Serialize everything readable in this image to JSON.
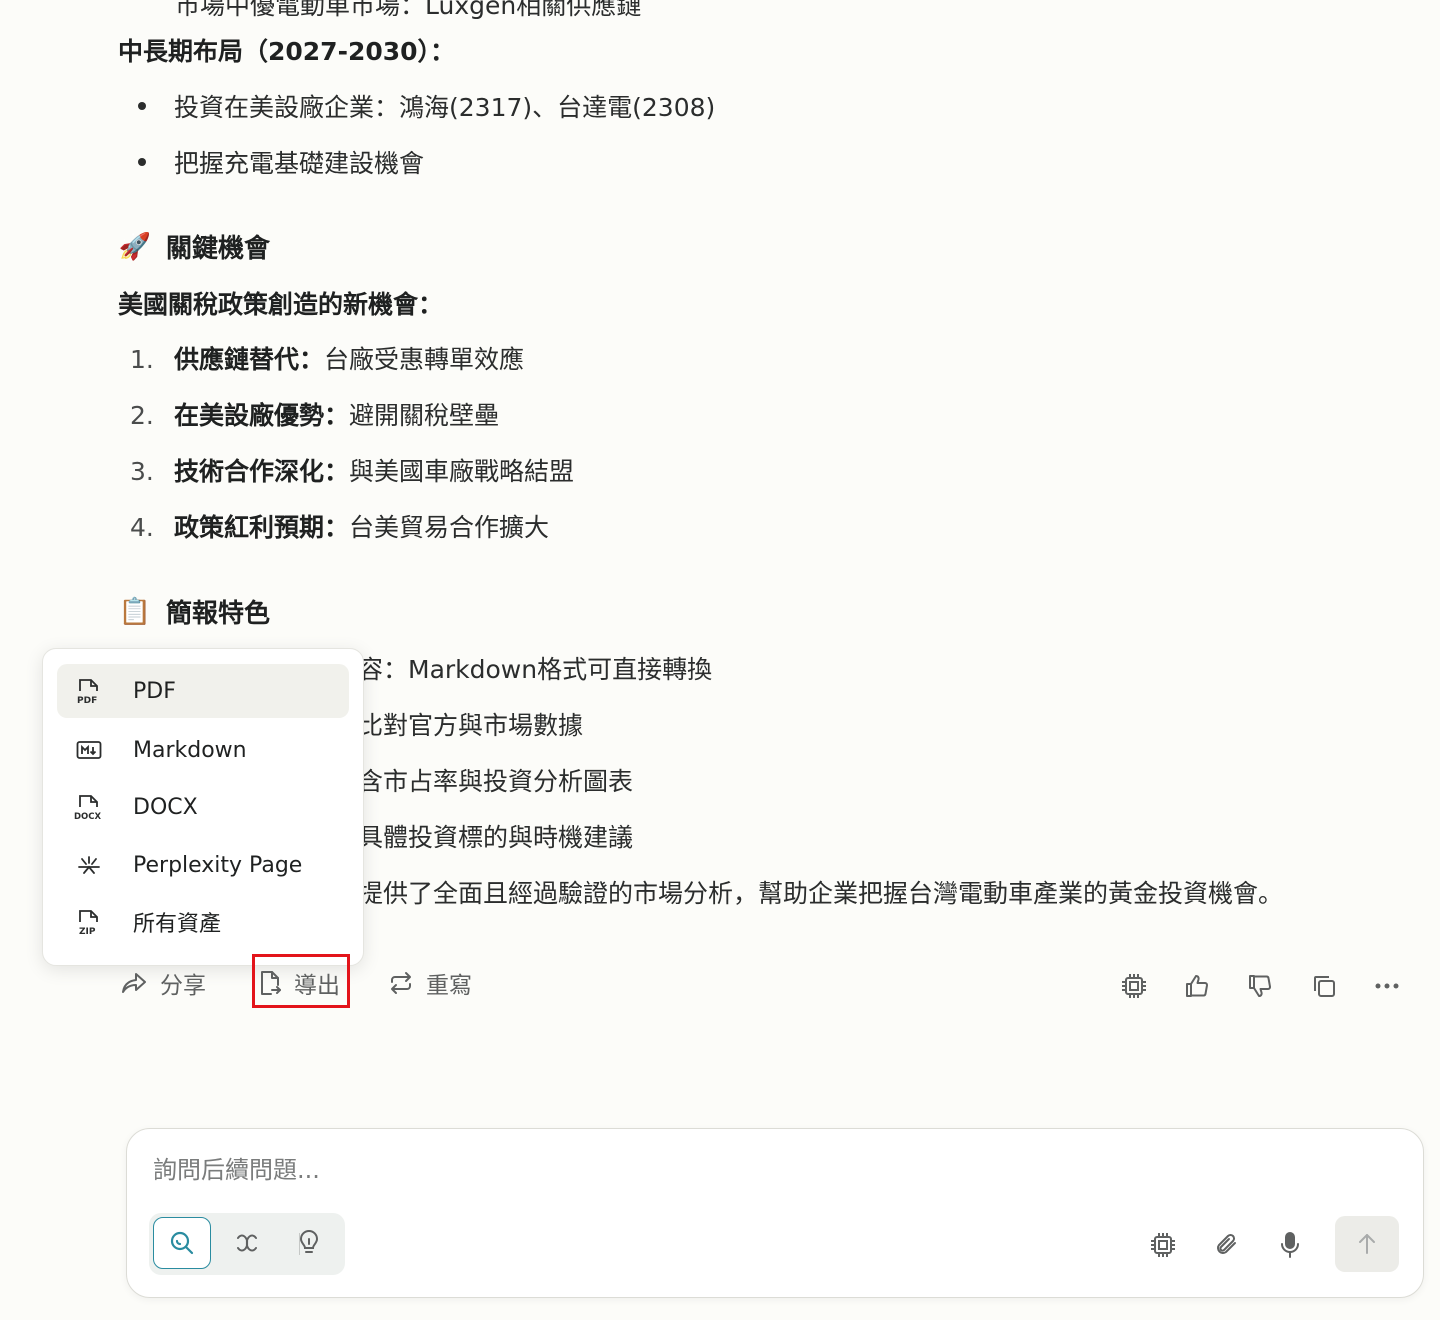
{
  "content": {
    "cutoff_line": "市場中優電動車市場：Luxgen相關供應鏈",
    "long_term_heading": "中長期布局（2027-2030）：",
    "long_term_bullets": [
      "投資在美設廠企業：鴻海(2317)、台達電(2308)",
      "把握充電基礎建設機會"
    ],
    "opportunities_section": {
      "emoji": "🚀",
      "title": "關鍵機會"
    },
    "opportunities_subheading": "美國關稅政策創造的新機會：",
    "opportunities_list": [
      {
        "num": "1.",
        "strong": "供應鏈替代：",
        "text": "台廠受惠轉單效應"
      },
      {
        "num": "2.",
        "strong": "在美設廠優勢：",
        "text": "避開關稅壁壘"
      },
      {
        "num": "3.",
        "strong": "技術合作深化：",
        "text": "與美國車廠戰略結盟"
      },
      {
        "num": "4.",
        "strong": "政策紅利預期：",
        "text": "台美貿易合作擴大"
      }
    ],
    "features_section": {
      "emoji": "📋",
      "title": "簡報特色"
    },
    "features_partial": [
      "容：Markdown格式可直接轉換",
      "比對官方與市場數據",
      "含市占率與投資分析圖表",
      "具體投資標的與時機建議",
      "提供了全面且經過驗證的市場分析，幫助企業把握台灣電動車產業的黃金投資機會。"
    ]
  },
  "export_menu": {
    "items": [
      {
        "label": "PDF",
        "icon": "pdf-file-icon"
      },
      {
        "label": "Markdown",
        "icon": "markdown-icon"
      },
      {
        "label": "DOCX",
        "icon": "docx-file-icon"
      },
      {
        "label": "Perplexity Page",
        "icon": "perplexity-icon"
      },
      {
        "label": "所有資產",
        "icon": "zip-file-icon"
      }
    ]
  },
  "actions": {
    "share": "分享",
    "export": "導出",
    "rewrite": "重寫"
  },
  "composer": {
    "placeholder": "詢問后續問題..."
  },
  "colors": {
    "accent": "#2a8ca0",
    "highlight": "#e3141a"
  }
}
